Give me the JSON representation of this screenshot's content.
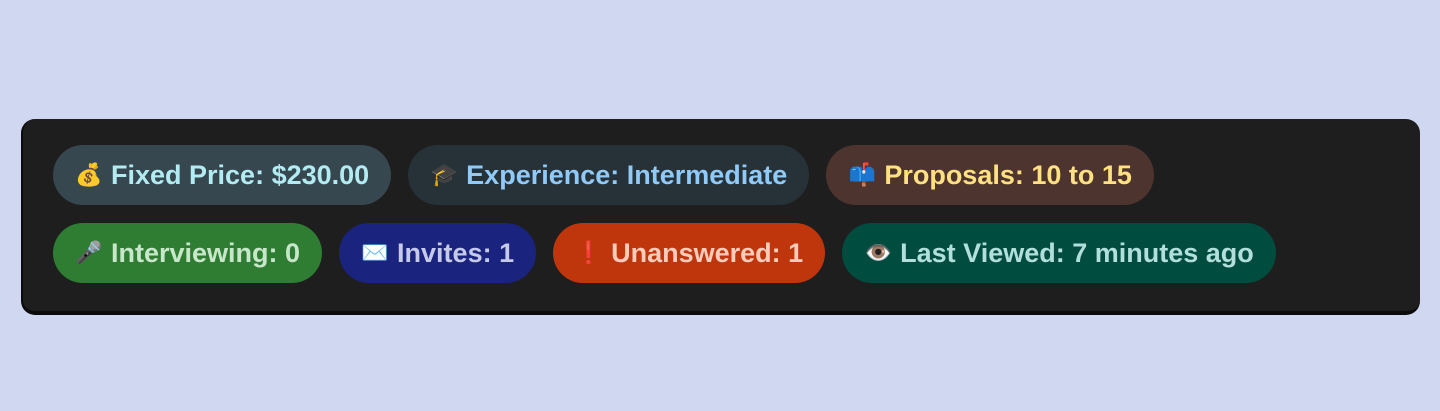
{
  "chips_row1": [
    {
      "label": "Fixed Price: $230.00",
      "icon": "money-bag-icon",
      "bg": "#37474f",
      "fg": "#b2ebf2"
    },
    {
      "label": "Experience: Intermediate",
      "icon": "graduation-cap-icon",
      "bg": "#263238",
      "fg": "#90caf9"
    },
    {
      "label": "Proposals: 10 to 15",
      "icon": "mailbox-icon",
      "bg": "#4e342e",
      "fg": "#ffe082"
    }
  ],
  "chips_row2": [
    {
      "label": "Interviewing: 0",
      "icon": "microphone-icon",
      "bg": "#2e7d32",
      "fg": "#c8e6c9"
    },
    {
      "label": "Invites: 1",
      "icon": "envelope-icon",
      "bg": "#1a237e",
      "fg": "#c5cae9"
    },
    {
      "label": "Unanswered: 1",
      "icon": "exclamation-icon",
      "bg": "#bf360c",
      "fg": "#ffccbc"
    },
    {
      "label": "Last Viewed: 7 minutes ago",
      "icon": "eye-icon",
      "bg": "#004d40",
      "fg": "#b2dfdb"
    }
  ]
}
